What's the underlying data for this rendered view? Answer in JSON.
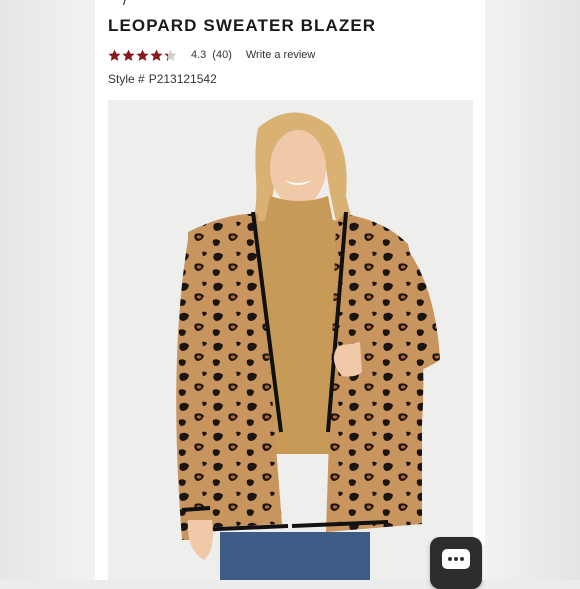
{
  "product": {
    "title": "LEOPARD SWEATER BLAZER",
    "rating_value": "4.3",
    "review_count": "(40)",
    "write_review": "Write a review",
    "style_label": "Style #",
    "style_number": "P213121542",
    "rating_stars": 4.3,
    "max_stars": 5
  },
  "icons": {
    "star": "star-icon",
    "chat": "chat-icon"
  },
  "colors": {
    "star_fill": "#8b1a1f",
    "star_empty": "#cfcfcf",
    "title": "#1a1a1a",
    "chat_button": "#2d2d2d"
  }
}
